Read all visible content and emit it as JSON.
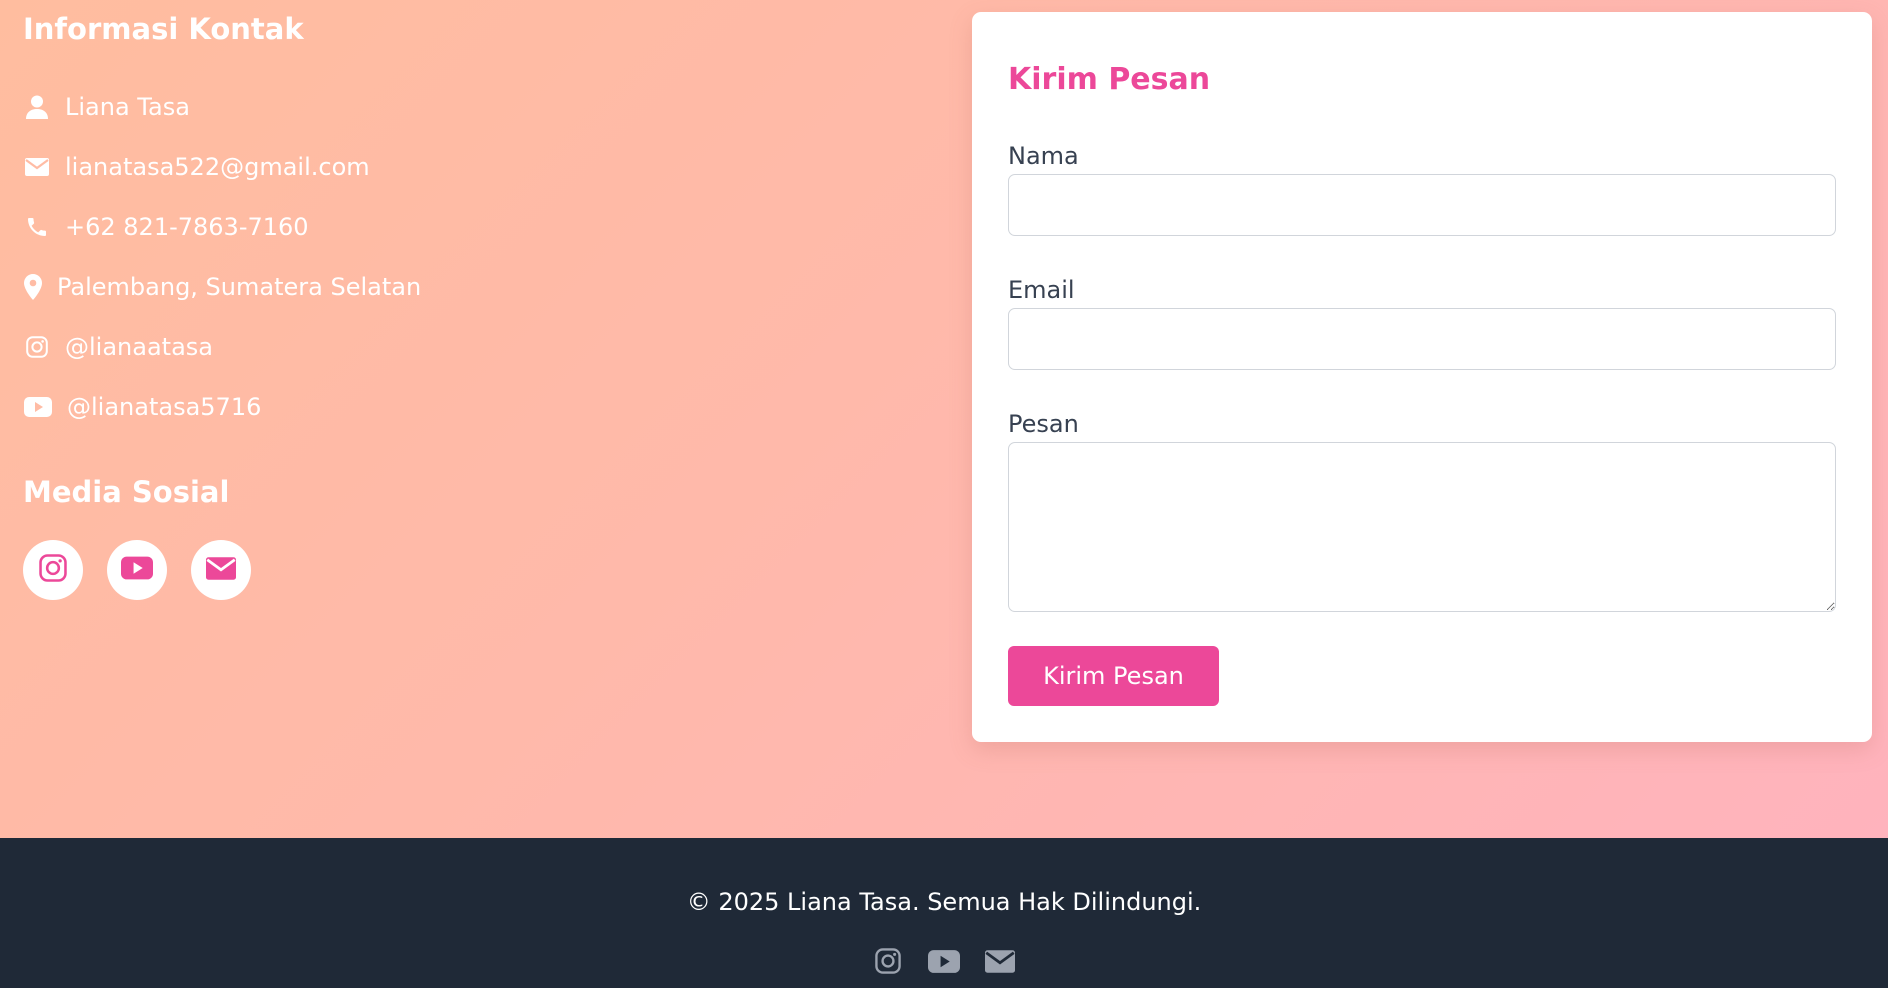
{
  "contact_info": {
    "title": "Informasi Kontak",
    "items": [
      {
        "icon": "user-icon",
        "text": "Liana Tasa"
      },
      {
        "icon": "envelope-icon",
        "text": "lianatasa522@gmail.com"
      },
      {
        "icon": "phone-icon",
        "text": "+62 821-7863-7160"
      },
      {
        "icon": "location-pin-icon",
        "text": "Palembang, Sumatera Selatan"
      },
      {
        "icon": "instagram-icon",
        "text": "@lianaatasa"
      },
      {
        "icon": "youtube-icon",
        "text": "@lianatasa5716"
      }
    ]
  },
  "social": {
    "title": "Media Sosial",
    "buttons": [
      {
        "icon": "instagram-icon"
      },
      {
        "icon": "youtube-icon"
      },
      {
        "icon": "envelope-icon"
      }
    ]
  },
  "form": {
    "title": "Kirim Pesan",
    "fields": {
      "name": {
        "label": "Nama",
        "value": ""
      },
      "email": {
        "label": "Email",
        "value": ""
      },
      "message": {
        "label": "Pesan",
        "value": ""
      }
    },
    "submit_label": "Kirim Pesan"
  },
  "footer": {
    "copyright": "© 2025 Liana Tasa. Semua Hak Dilindungi.",
    "icons": [
      "instagram-icon",
      "youtube-icon",
      "envelope-icon"
    ]
  },
  "colors": {
    "accent": "#ec4899",
    "footer_bg": "#1f2937",
    "footer_icon": "#9ca3af",
    "gradient_start": "#ffbd9f",
    "gradient_end": "#ffb3bd"
  }
}
